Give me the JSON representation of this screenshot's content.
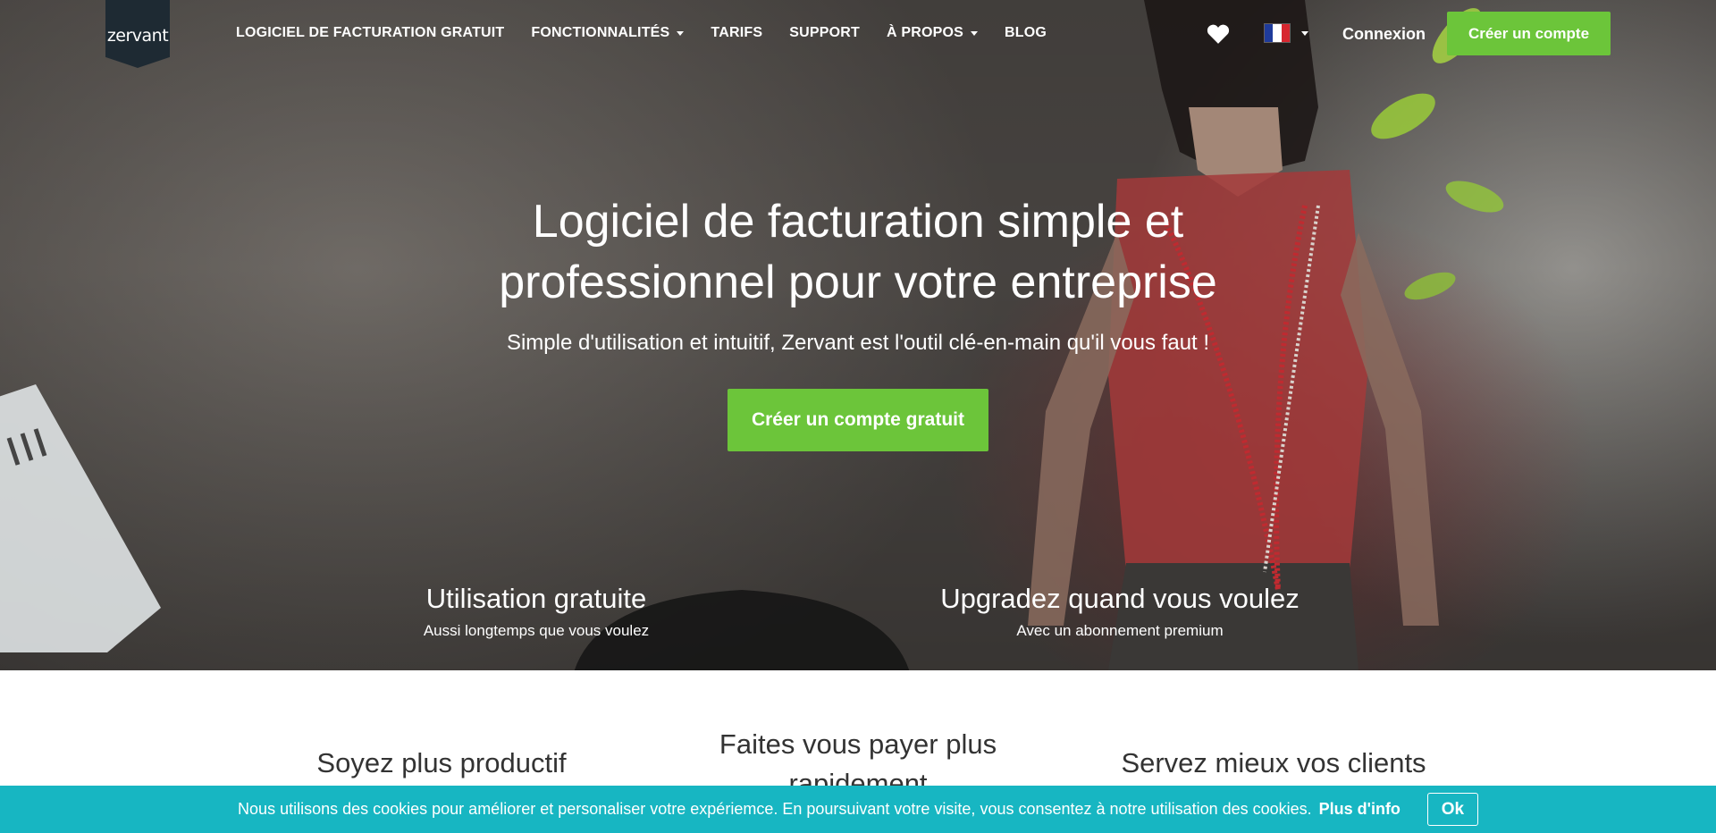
{
  "brand": {
    "logo_text": "zervant"
  },
  "nav": {
    "items": [
      {
        "label": "LOGICIEL DE FACTURATION GRATUIT",
        "dropdown": false
      },
      {
        "label": "FONCTIONNALITÉS",
        "dropdown": true
      },
      {
        "label": "TARIFS",
        "dropdown": false
      },
      {
        "label": "SUPPORT",
        "dropdown": false
      },
      {
        "label": "À PROPOS",
        "dropdown": true
      },
      {
        "label": "BLOG",
        "dropdown": false
      }
    ],
    "login_label": "Connexion",
    "signup_label": "Créer un compte"
  },
  "hero": {
    "title": "Logiciel de facturation simple et professionnel pour votre entreprise",
    "subtitle": "Simple d'utilisation et intuitif, Zervant est l'outil clé-en-main qu'il vous faut !",
    "cta_label": "Créer un compte gratuit",
    "features": [
      {
        "title": "Utilisation gratuite",
        "subtitle": "Aussi longtemps que vous voulez"
      },
      {
        "title": "Upgradez quand vous voulez",
        "subtitle": "Avec un abonnement premium"
      }
    ]
  },
  "benefits": [
    {
      "title": "Soyez plus productif"
    },
    {
      "title": "Faites vous payer plus rapidement"
    },
    {
      "title": "Servez mieux vos clients"
    }
  ],
  "cookie": {
    "text": "Nous utilisons des cookies pour améliorer et personaliser votre expériemce. En poursuivant votre visite, vous consentez à notre utilisation des cookies.",
    "more_label": "Plus d'info",
    "ok_label": "Ok"
  },
  "colors": {
    "accent_green": "#6cc53a",
    "cookie_bar": "#17b6c2",
    "logo_bg": "#1e2a33",
    "flag": [
      "#1f3b9b",
      "#ffffff",
      "#d7262f"
    ]
  },
  "icons": [
    "heart-icon",
    "france-flag-icon",
    "chevron-down-icon"
  ]
}
